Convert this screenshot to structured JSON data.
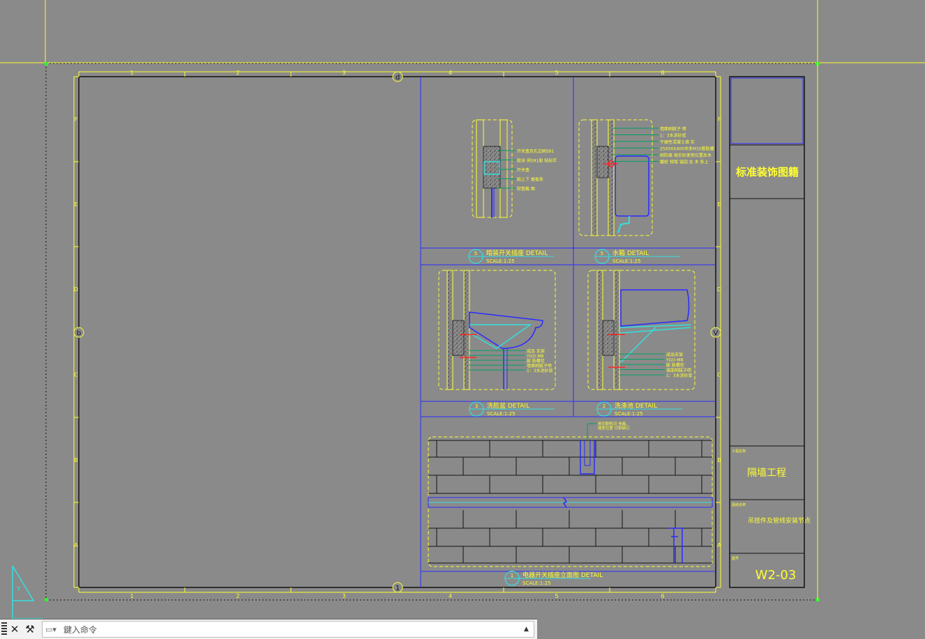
{
  "sheet": {
    "col_labels": [
      "1",
      "2",
      "3",
      "4",
      "5",
      "6"
    ],
    "row_labels": [
      "F",
      "E",
      "D",
      "C",
      "B",
      "A"
    ],
    "markers": {
      "top": "d",
      "left": "b",
      "right": "V",
      "bottom": "1"
    }
  },
  "title_block": {
    "company": "标准装饰图籍",
    "project_label": "工程名称",
    "project": "隔墙工程",
    "drawing_label": "图纸名称",
    "drawing": "吊挂件及管线安装节点",
    "number_label": "图号",
    "number": "W2-03"
  },
  "details": [
    {
      "num": "5",
      "title": "暗装开关插座  DETAIL",
      "scale": "SCALE:1:25"
    },
    {
      "num": "5",
      "title": "水箱  DETAIL",
      "scale": "SCALE:1:25"
    },
    {
      "num": "3",
      "title": "洗脸盆  DETAIL",
      "scale": "SCALE:1:25"
    },
    {
      "num": "2",
      "title": "洗涤池  DETAIL",
      "scale": "SCALE:1:25"
    },
    {
      "num": "1",
      "title": "电器开关插座立面图  DETAIL",
      "scale": "SCALE:1:25"
    }
  ],
  "notes": {
    "switch": [
      "开关盒及孔边刷S91",
      "胶涂 用S91胶 粘贴牢",
      "开关盒",
      "跑上下 盖板条",
      "软管截 面"
    ],
    "tank": [
      "墙面刷腻子 喷",
      "1：3水泥砂浆",
      "干硬性混凝土填 实",
      "25X50X400木条M10膨胀螺",
      "刷防腐 按实际使用位置及木",
      "螺栓 预埋 锚固 在 木 条上"
    ],
    "basin": [
      "成品 支架",
      "YGO-M8",
      "膨 胀螺栓",
      "墙面刷腻子喷",
      "1：3水泥砂浆"
    ],
    "sink": [
      "成品支架",
      "YGO-M8",
      "膨 胀螺栓",
      "墙面刷腻子喷",
      "1：3水泥砂浆"
    ],
    "elevation": [
      "用切割机切 电箱、",
      "插座位置 切割缺口"
    ]
  },
  "command": {
    "placeholder": "鍵入命令"
  },
  "colors": {
    "background": "#8a8a8a",
    "frame": "#ffff33",
    "blue": "#2a2aff",
    "cyan": "#33e0e0",
    "green": "#00a060",
    "red": "#ff2222"
  }
}
